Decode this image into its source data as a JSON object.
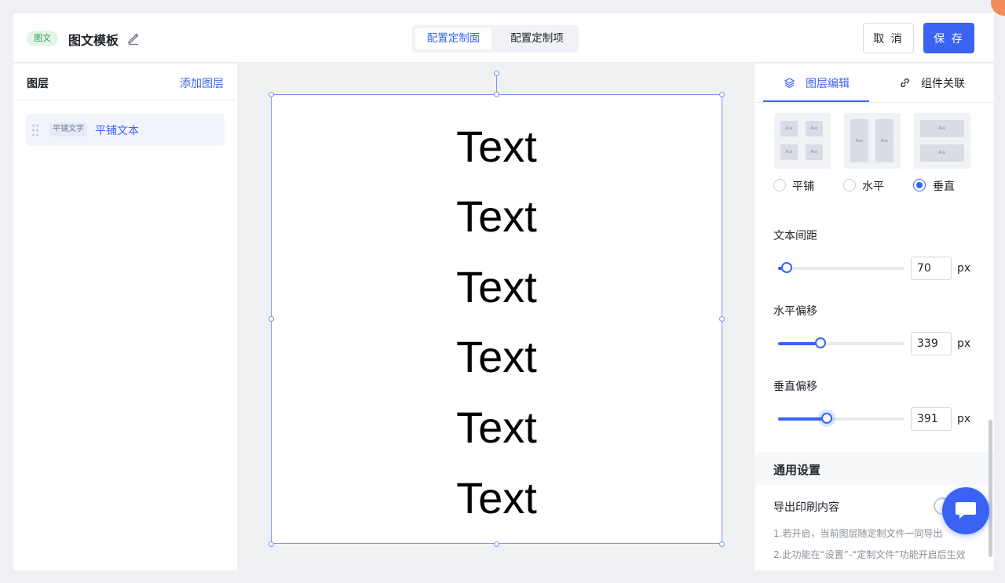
{
  "header": {
    "tag": "图文",
    "title": "图文模板",
    "tabs": [
      {
        "label": "配置定制面",
        "active": true
      },
      {
        "label": "配置定制项",
        "active": false
      }
    ],
    "cancel_label": "取 消",
    "save_label": "保 存"
  },
  "layers": {
    "title": "图层",
    "add_label": "添加图层",
    "items": [
      {
        "tag": "平铺文字",
        "name": "平铺文本"
      }
    ]
  },
  "canvas": {
    "texts": [
      "Text",
      "Text",
      "Text",
      "Text",
      "Text",
      "Text"
    ]
  },
  "panel": {
    "tabs": [
      {
        "label": "图层编辑",
        "active": true
      },
      {
        "label": "组件关联",
        "active": false
      }
    ],
    "layout_modes": [
      {
        "label": "平铺",
        "selected": false
      },
      {
        "label": "水平",
        "selected": false
      },
      {
        "label": "垂直",
        "selected": true
      }
    ],
    "cell_label": "A≡",
    "text_spacing": {
      "label": "文本间距",
      "value": "70",
      "unit": "px",
      "fraction": 0.07
    },
    "h_offset": {
      "label": "水平偏移",
      "value": "339",
      "unit": "px",
      "fraction": 0.34
    },
    "v_offset": {
      "label": "垂直偏移",
      "value": "391",
      "unit": "px",
      "fraction": 0.39
    },
    "general": {
      "title": "通用设置",
      "export_label": "导出印刷内容",
      "export_enabled": false,
      "note1": "1.若开启，当前图层随定制文件一同导出",
      "note2": "2.此功能在“设置”-“定制文件”功能开启后生效"
    }
  },
  "colors": {
    "accent": "#3a63f3",
    "tag_bg": "#e4f4ea",
    "tag_text": "#37a05c"
  }
}
